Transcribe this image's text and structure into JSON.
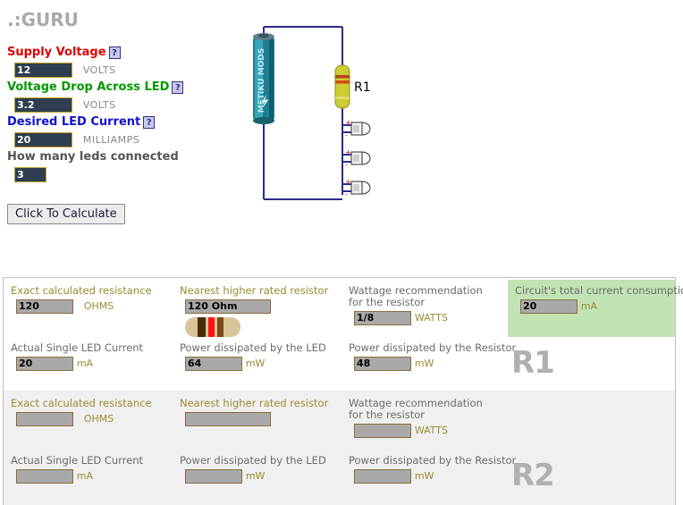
{
  "header": {
    "title": ".:GURU"
  },
  "form": {
    "help_glyph": "?",
    "fields": [
      {
        "label": "Supply Voltage",
        "value": "12",
        "unit": "VOLTS",
        "color": "red",
        "help": true
      },
      {
        "label": "Voltage Drop Across LED",
        "value": "3.2",
        "unit": "VOLTS",
        "color": "green",
        "help": true
      },
      {
        "label": "Desired LED Current",
        "value": "20",
        "unit": "MILLIAMPS",
        "color": "blue",
        "help": true
      },
      {
        "label": "How many leds connected",
        "value": "3",
        "unit": "",
        "color": "gray",
        "help": false
      }
    ],
    "calculate_label": "Click To Calculate"
  },
  "circuit": {
    "battery_label": "METIKU MODS",
    "resistor_label": "R1",
    "led_plus": "+",
    "led_minus": "-",
    "led_count": 3
  },
  "results": {
    "blocks": [
      {
        "tag": "R1",
        "exact_resistance_label": "Exact calculated resistance",
        "exact_resistance_value": "120",
        "exact_resistance_unit": "OHMS",
        "nearest_label": "Nearest higher rated resistor",
        "nearest_value": "120 Ohm",
        "show_band_image": true,
        "wattage_label": "Wattage recommendation for the resistor",
        "wattage_value": "1/8",
        "wattage_unit": "WATTS",
        "total_current_label": "Circuit's total current consumption",
        "total_current_value": "20",
        "total_current_unit": "mA",
        "show_total_current": true,
        "led_current_label": "Actual Single LED Current",
        "led_current_value": "20",
        "led_current_unit": "mA",
        "led_power_label": "Power dissipated by the LED",
        "led_power_value": "64",
        "led_power_unit": "mW",
        "res_power_label": "Power dissipated by the Resistor",
        "res_power_value": "48",
        "res_power_unit": "mW"
      },
      {
        "tag": "R2",
        "exact_resistance_label": "Exact calculated resistance",
        "exact_resistance_value": "",
        "exact_resistance_unit": "OHMS",
        "nearest_label": "Nearest higher rated resistor",
        "nearest_value": "",
        "show_band_image": false,
        "wattage_label": "Wattage recommendation for the resistor",
        "wattage_value": "",
        "wattage_unit": "WATTS",
        "total_current_label": "",
        "total_current_value": "",
        "total_current_unit": "",
        "show_total_current": false,
        "led_current_label": "Actual Single LED Current",
        "led_current_value": "",
        "led_current_unit": "mA",
        "led_power_label": "Power dissipated by the LED",
        "led_power_value": "",
        "led_power_unit": "mW",
        "res_power_label": "Power dissipated by the Resistor",
        "res_power_value": "",
        "res_power_unit": "mW"
      }
    ]
  },
  "colors": {
    "input_bg": "#2e3e50",
    "input_border": "#c9a227",
    "result_bg": "#a9a9a9",
    "result_border": "#8a6d3b",
    "label_olive": "#9a8b32",
    "highlight_green": "#c2e3b4",
    "wire": "#2b2b8c",
    "resistor_body": "#cccc33",
    "title_gray": "#a9a9a9"
  }
}
